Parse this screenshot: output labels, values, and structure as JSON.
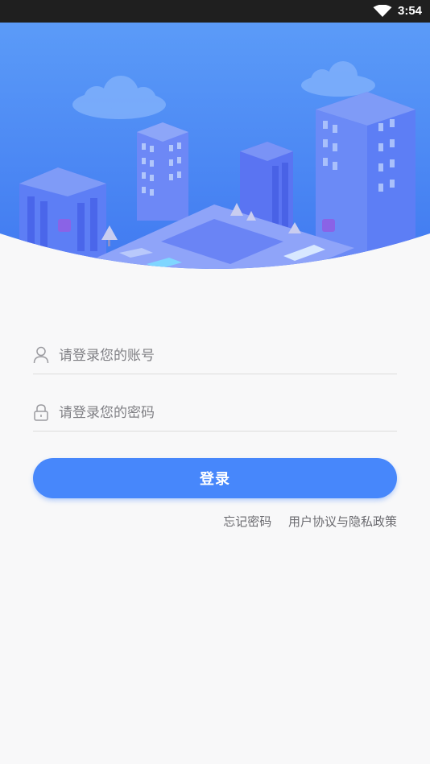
{
  "status_bar": {
    "time": "3:54",
    "wifi_icon": "wifi-icon"
  },
  "hero": {
    "illustration": "city-illustration"
  },
  "login_form": {
    "account_placeholder": "请登录您的账号",
    "account_icon": "user-icon",
    "password_placeholder": "请登录您的密码",
    "password_icon": "lock-icon",
    "submit_label": "登录"
  },
  "links": {
    "forgot_password": "忘记密码",
    "agreement": "用户协议与隐私政策"
  },
  "colors": {
    "primary": "#4787fb",
    "status_bar": "#1f1f1f",
    "background": "#f8f8f9"
  }
}
